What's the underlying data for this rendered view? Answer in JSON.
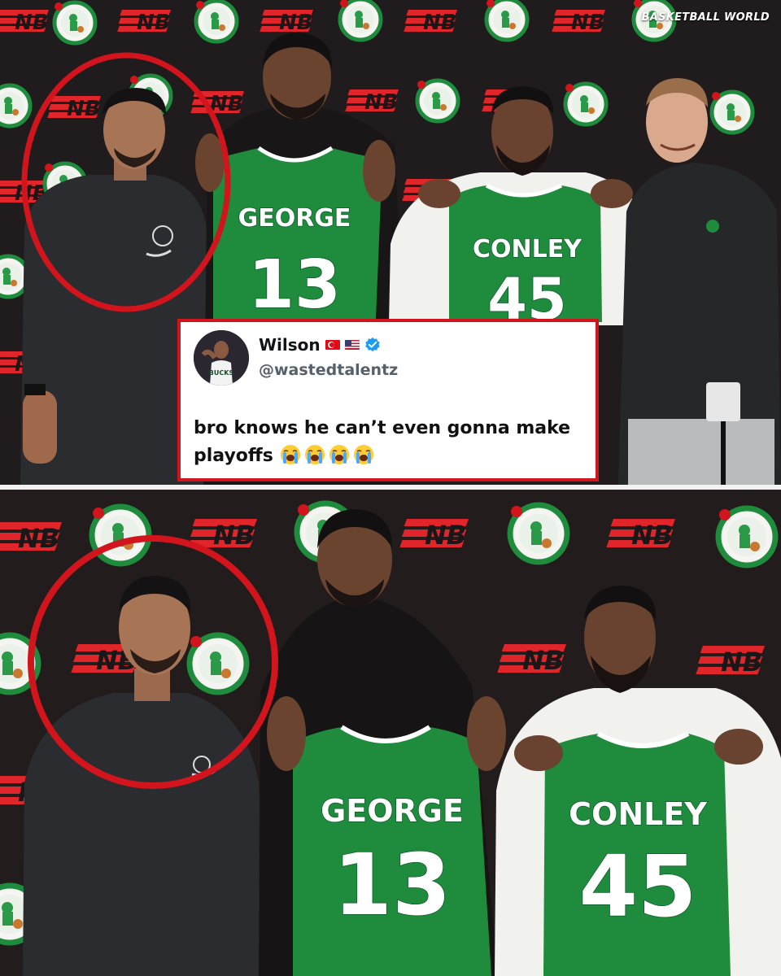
{
  "watermark": "BASKETBALL WORLD",
  "jerseys": {
    "george_name": "GEORGE",
    "george_number": "13",
    "conley_name": "CONLEY",
    "conley_number": "45"
  },
  "tweet": {
    "display_name": "Wilson",
    "handle": "@wastedtalentz",
    "text": "bro knows he can’t even gonna make playoffs",
    "emoji_count": 4,
    "emoji": "loudly-crying-face",
    "flags": [
      "turkey-flag-icon",
      "usa-flag-icon"
    ],
    "verified": true
  },
  "colors": {
    "highlight_red": "#d2141c",
    "celtics_green": "#1f8b3c",
    "nb_red": "#e0262a",
    "verified_blue": "#1d9bf0"
  },
  "icons": {
    "logo_pattern": [
      "celtics-logo-icon",
      "new-balance-logo-icon"
    ],
    "highlight": "red-circle-highlight"
  }
}
